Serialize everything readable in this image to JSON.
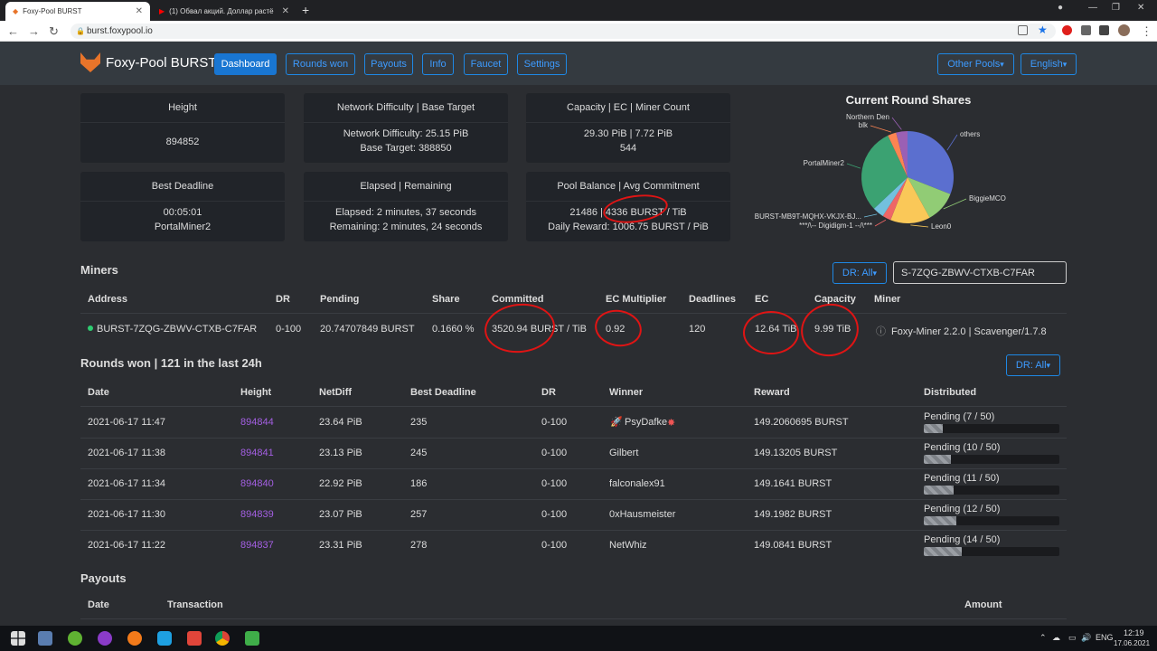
{
  "browser": {
    "tabs": [
      {
        "label": "Foxy-Pool BURST"
      },
      {
        "label": "(1) Обвал акций. Доллар растё"
      }
    ],
    "url": "burst.foxypool.io"
  },
  "nav": {
    "brand": "Foxy-Pool BURST",
    "items": [
      "Dashboard",
      "Rounds won",
      "Payouts",
      "Info",
      "Faucet",
      "Settings"
    ],
    "active": "Dashboard",
    "other_pools": "Other Pools",
    "language": "English"
  },
  "stats": {
    "height": {
      "title": "Height",
      "value": "894852"
    },
    "difficulty": {
      "title": "Network Difficulty | Base Target",
      "line1": "Network Difficulty: 25.15 PiB",
      "line2": "Base Target: 388850"
    },
    "capacity": {
      "title": "Capacity | EC | Miner Count",
      "line1": "29.30 PiB | 7.72 PiB",
      "line2": "544"
    },
    "deadline": {
      "title": "Best Deadline",
      "line1": "00:05:01",
      "line2": "PortalMiner2"
    },
    "elapsed": {
      "title": "Elapsed | Remaining",
      "line1": "Elapsed: 2 minutes, 37 seconds",
      "line2": "Remaining: 2 minutes, 24 seconds"
    },
    "balance": {
      "title": "Pool Balance | Avg Commitment",
      "line1": "21486 | 4336 BURST / TiB",
      "line2": "Daily Reward: 1006.75 BURST / PiB"
    }
  },
  "chart_data": {
    "type": "pie",
    "title": "Current Round Shares",
    "slices": [
      {
        "label": "others",
        "value": 31,
        "color": "#5b6fcf"
      },
      {
        "label": "BiggieMCO",
        "value": 11,
        "color": "#91cc75"
      },
      {
        "label": "Leon0",
        "value": 14,
        "color": "#fac858"
      },
      {
        "label": "***/\\-- Digidigm-1 --/\\***",
        "value": 3,
        "color": "#ee6666"
      },
      {
        "label": "BURST-MB9T-MQHX-VKJX-BJ...",
        "value": 4,
        "color": "#73c0de"
      },
      {
        "label": "PortalMiner2",
        "value": 30,
        "color": "#3ba272"
      },
      {
        "label": "blk",
        "value": 3,
        "color": "#fc8452"
      },
      {
        "label": "Northern Den",
        "value": 4,
        "color": "#9a60b4"
      }
    ]
  },
  "miners": {
    "title": "Miners",
    "dr_filter": "DR: All",
    "search_value": "S-7ZQG-ZBWV-CTXB-C7FAR",
    "headers": [
      "Address",
      "DR",
      "Pending",
      "Share",
      "Committed",
      "EC Multiplier",
      "Deadlines",
      "EC",
      "Capacity",
      "Miner"
    ],
    "row": {
      "address": "BURST-7ZQG-ZBWV-CTXB-C7FAR",
      "dr": "0-100",
      "pending": "20.74707849 BURST",
      "share": "0.1660 %",
      "committed": "3520.94 BURST / TiB",
      "ec_multiplier": "0.92",
      "deadlines": "120",
      "ec": "12.64 TiB",
      "capacity": "9.99 TiB",
      "miner": "Foxy-Miner 2.2.0 | Scavenger/1.7.8"
    }
  },
  "rounds": {
    "title": "Rounds won | 121 in the last 24h",
    "dr_filter": "DR: All",
    "headers": [
      "Date",
      "Height",
      "NetDiff",
      "Best Deadline",
      "DR",
      "Winner",
      "Reward",
      "Distributed"
    ],
    "rows": [
      {
        "date": "2021-06-17 11:47",
        "height": "894844",
        "netdiff": "23.64 PiB",
        "deadline": "235",
        "dr": "0-100",
        "winner": "PsyDafke",
        "reward": "149.2060695 BURST",
        "distributed": "Pending (7 / 50)",
        "progress": 0.14
      },
      {
        "date": "2021-06-17 11:38",
        "height": "894841",
        "netdiff": "23.13 PiB",
        "deadline": "245",
        "dr": "0-100",
        "winner": "Gilbert",
        "reward": "149.13205 BURST",
        "distributed": "Pending (10 / 50)",
        "progress": 0.2
      },
      {
        "date": "2021-06-17 11:34",
        "height": "894840",
        "netdiff": "22.92 PiB",
        "deadline": "186",
        "dr": "0-100",
        "winner": "falconalex91",
        "reward": "149.1641 BURST",
        "distributed": "Pending (11 / 50)",
        "progress": 0.22
      },
      {
        "date": "2021-06-17 11:30",
        "height": "894839",
        "netdiff": "23.07 PiB",
        "deadline": "257",
        "dr": "0-100",
        "winner": "0xHausmeister",
        "reward": "149.1982 BURST",
        "distributed": "Pending (12 / 50)",
        "progress": 0.24
      },
      {
        "date": "2021-06-17 11:22",
        "height": "894837",
        "netdiff": "23.31 PiB",
        "deadline": "278",
        "dr": "0-100",
        "winner": "NetWhiz",
        "reward": "149.0841 BURST",
        "distributed": "Pending (14 / 50)",
        "progress": 0.28
      }
    ]
  },
  "payouts": {
    "title": "Payouts",
    "headers": [
      "Date",
      "Transaction",
      "Amount"
    ]
  },
  "taskbar": {
    "lang": "ENG",
    "time": "12:19",
    "date": "17.06.2021"
  }
}
